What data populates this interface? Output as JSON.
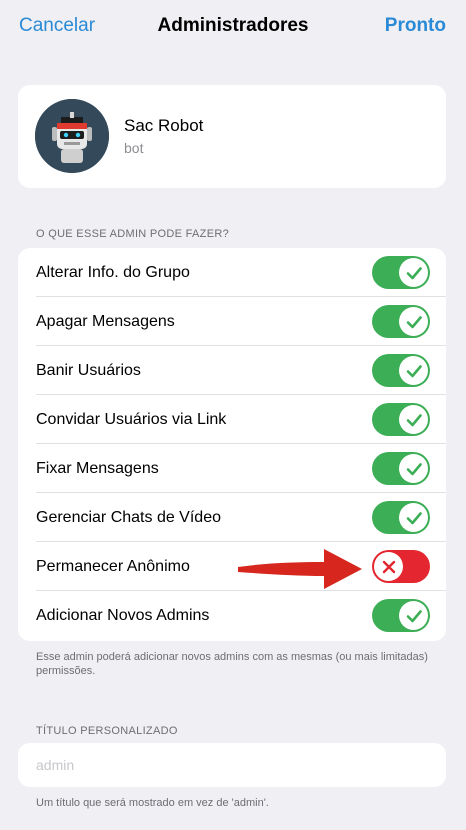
{
  "nav": {
    "cancel": "Cancelar",
    "title": "Administradores",
    "done": "Pronto"
  },
  "profile": {
    "name": "Sac Robot",
    "subtitle": "bot"
  },
  "permissions": {
    "header": "O QUE ESSE ADMIN PODE FAZER?",
    "items": [
      {
        "label": "Alterar Info. do Grupo",
        "enabled": true
      },
      {
        "label": "Apagar Mensagens",
        "enabled": true
      },
      {
        "label": "Banir Usuários",
        "enabled": true
      },
      {
        "label": "Convidar Usuários via Link",
        "enabled": true
      },
      {
        "label": "Fixar Mensagens",
        "enabled": true
      },
      {
        "label": "Gerenciar Chats de Vídeo",
        "enabled": true
      },
      {
        "label": "Permanecer Anônimo",
        "enabled": false
      },
      {
        "label": "Adicionar Novos Admins",
        "enabled": true
      }
    ],
    "footer": "Esse admin poderá adicionar novos admins com as mesmas (ou mais limitadas) permissões."
  },
  "custom_title": {
    "header": "TÍTULO PERSONALIZADO",
    "placeholder": "admin",
    "value": "",
    "footer": "Um título que será mostrado em vez de 'admin'."
  },
  "colors": {
    "accent": "#2a8ad6",
    "toggle_on": "#3cae55",
    "toggle_off": "#e3262f",
    "annotation_arrow": "#d6261e"
  }
}
